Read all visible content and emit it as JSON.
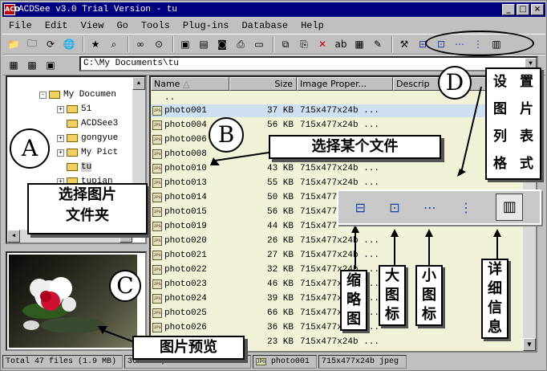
{
  "window": {
    "title": "ACDSee v3.0 Trial Version - tu"
  },
  "menu": [
    "File",
    "Edit",
    "View",
    "Go",
    "Tools",
    "Plug-ins",
    "Database",
    "Help"
  ],
  "address": {
    "path": "C:\\My Documents\\tu"
  },
  "tree": [
    {
      "label": "My Documen",
      "expander": "-",
      "depth": 0
    },
    {
      "label": "51",
      "expander": "+",
      "depth": 1
    },
    {
      "label": "ACDSee3",
      "expander": "",
      "depth": 1
    },
    {
      "label": "gongyue",
      "expander": "+",
      "depth": 1
    },
    {
      "label": "My Pict",
      "expander": "+",
      "depth": 1
    },
    {
      "label": "tu",
      "expander": "",
      "depth": 1
    },
    {
      "label": "tupian",
      "expander": "+",
      "depth": 1
    }
  ],
  "list": {
    "columns": [
      "Name",
      "Size",
      "Image Proper...",
      "Descrip"
    ],
    "parent": "..",
    "rows": [
      {
        "name": "photo001",
        "size": "37 KB",
        "props": "715x477x24b ...",
        "selected": true
      },
      {
        "name": "photo004",
        "size": "56 KB",
        "props": "715x477x24b ..."
      },
      {
        "name": "photo006",
        "size": "",
        "props": ""
      },
      {
        "name": "photo008",
        "size": "",
        "props": ""
      },
      {
        "name": "photo010",
        "size": "43 KB",
        "props": "715x477x24b ..."
      },
      {
        "name": "photo013",
        "size": "55 KB",
        "props": "715x477x24b ..."
      },
      {
        "name": "photo014",
        "size": "50 KB",
        "props": "715x477"
      },
      {
        "name": "photo015",
        "size": "56 KB",
        "props": "715x477"
      },
      {
        "name": "photo019",
        "size": "44 KB",
        "props": "715x477"
      },
      {
        "name": "photo020",
        "size": "26 KB",
        "props": "715x477x24b ..."
      },
      {
        "name": "photo021",
        "size": "27 KB",
        "props": "715x477x24b ..."
      },
      {
        "name": "photo022",
        "size": "32 KB",
        "props": "715x477x24b ..."
      },
      {
        "name": "photo023",
        "size": "46 KB",
        "props": "715x477x24b ..."
      },
      {
        "name": "photo024",
        "size": "39 KB",
        "props": "715x477x24b ..."
      },
      {
        "name": "photo025",
        "size": "66 KB",
        "props": "715x477x24b ..."
      },
      {
        "name": "photo026",
        "size": "36 KB",
        "props": "715x477x24b ..."
      },
      {
        "name": "photo034",
        "size": "23 KB",
        "props": "715x477x24b ..."
      }
    ]
  },
  "status": {
    "total": "Total 47 files (1.9 MB)",
    "date": "36.8 KB, 1999-12-13 11:52",
    "file": "photo001",
    "props": "715x477x24b jpeg"
  },
  "annotations": {
    "A": "A",
    "B": "B",
    "C": "C",
    "D": "D",
    "select_folder": [
      "选择图片",
      "文件夹"
    ],
    "select_file": "选择某个文件",
    "preview": "图片预览",
    "set_list_format": [
      "设",
      "置",
      "图",
      "片",
      "列",
      "表",
      "格",
      "式"
    ],
    "thumbnail": [
      "缩",
      "略",
      "图"
    ],
    "large_icon": [
      "大",
      "图",
      "标"
    ],
    "small_icon": [
      "小",
      "图",
      "标"
    ],
    "details": [
      "详",
      "细",
      "信",
      "息"
    ]
  }
}
